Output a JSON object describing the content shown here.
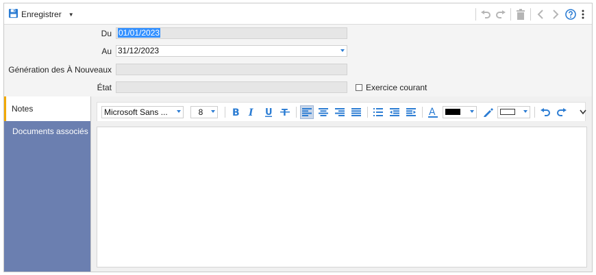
{
  "toolbar": {
    "save_label": "Enregistrer",
    "save_icon": "floppy-disk-icon",
    "right_icons": [
      "undo-icon",
      "redo-icon",
      "trash-icon",
      "previous-icon",
      "next-icon",
      "help-icon",
      "more-vertical-icon"
    ]
  },
  "form": {
    "du_label": "Du",
    "du_value": "01/01/2023",
    "au_label": "Au",
    "au_value": "31/12/2023",
    "generation_label": "Génération des À Nouveaux",
    "generation_value": "",
    "etat_label": "État",
    "etat_value": "",
    "exercice_label": "Exercice courant",
    "exercice_checked": false
  },
  "tabs": {
    "notes_label": "Notes",
    "documents_label": "Documents associés",
    "active": "Notes",
    "active_accent": "#f2a900",
    "panel_color": "#6b7fb0"
  },
  "editor": {
    "font_name": "Microsoft Sans ...",
    "font_size": "8",
    "text_color": "#000000",
    "accent": "#2b7cd3",
    "body_text": ""
  }
}
